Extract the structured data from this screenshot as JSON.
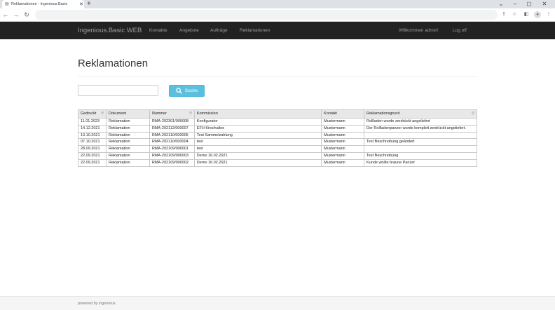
{
  "browser": {
    "tab_title": "Reklamationen - Ingenious.Basic",
    "tab_close": "✕",
    "new_tab": "+",
    "win_minimize": "–",
    "win_maximize": "▢",
    "win_close": "✕",
    "win_chevron": "⌄"
  },
  "navbar": {
    "brand": "Ingenious.Basic WEB",
    "links": [
      "Kontakte",
      "Angebote",
      "Aufträge",
      "Reklamationen"
    ],
    "welcome": "Willkommen admin!",
    "logoff": "Log off"
  },
  "page": {
    "title": "Reklamationen"
  },
  "search": {
    "value": "",
    "placeholder": "",
    "button_label": "Suche"
  },
  "table": {
    "columns": [
      "Gedruckt",
      "Dokument",
      "Nummer",
      "Kommission",
      "Kontakt",
      "Reklamationsgrund"
    ],
    "rows": [
      [
        "11.01.2023",
        "Reklamation",
        "RMA-202301/000008",
        "Konfigurator",
        "Mustermann",
        "Rollladen wurde zerdrückt angeliefert"
      ],
      [
        "14.12.2021",
        "Reklamation",
        "RMA-202112/000007",
        "EFH Kirschallee",
        "Mustermann",
        "Der Rollladenpanzer wurde komplett zerdrückt angeliefert."
      ],
      [
        "13.10.2021",
        "Reklamation",
        "RMA-202110/000005",
        "Test Sammelzahlung",
        "Mustermann",
        ""
      ],
      [
        "07.10.2021",
        "Reklamation",
        "RMA-202110/000004",
        "test",
        "Mustermann",
        "Test Beschreibung geändert"
      ],
      [
        "28.09.2021",
        "Reklamation",
        "RMA-202109/000001",
        "test",
        "Mustermann",
        ""
      ],
      [
        "22.09.2021",
        "Reklamation",
        "RMA-202109/000003",
        "Demo 16.02.2021",
        "Mustermann",
        "Test Beschreibung"
      ],
      [
        "22.09.2021",
        "Reklamation",
        "RMA-202109/000002",
        "Demo 16.02.2021",
        "Mustermann",
        "Kunde wollte braune Panzer"
      ]
    ]
  },
  "footer": {
    "text": "powered by ingenious"
  },
  "colors": {
    "navbar_bg": "#222222",
    "button_info": "#5bc0de"
  }
}
